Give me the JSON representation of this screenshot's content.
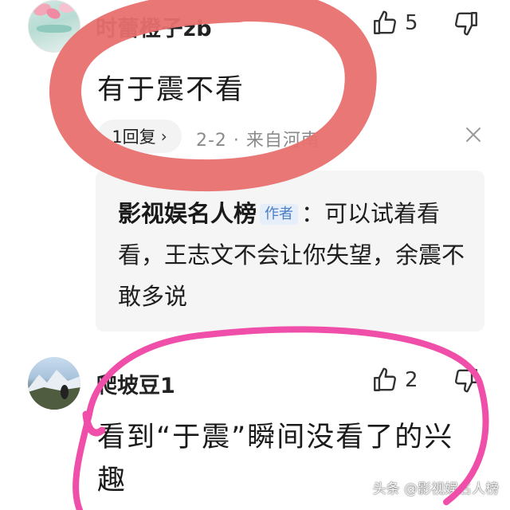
{
  "comments": [
    {
      "username": "时蕾橙子zb",
      "like_count": "5",
      "content": "有于震不看",
      "reply_button": "1回复",
      "meta": "2-2 · 来自河南",
      "author_reply": {
        "name": "影视娱名人榜",
        "tag": "作者",
        "text": "：可以试着看看，王志文不会让你失望，余震不敢多说"
      }
    },
    {
      "username": "爬坡豆1",
      "like_count": "2",
      "content": "看到“于震”瞬间没看了的兴趣"
    }
  ],
  "watermark": "头条 @影视娱名人榜",
  "annotation_colors": {
    "top_circle": "#e8706f",
    "bottom_circle": "#ef4fa8"
  }
}
